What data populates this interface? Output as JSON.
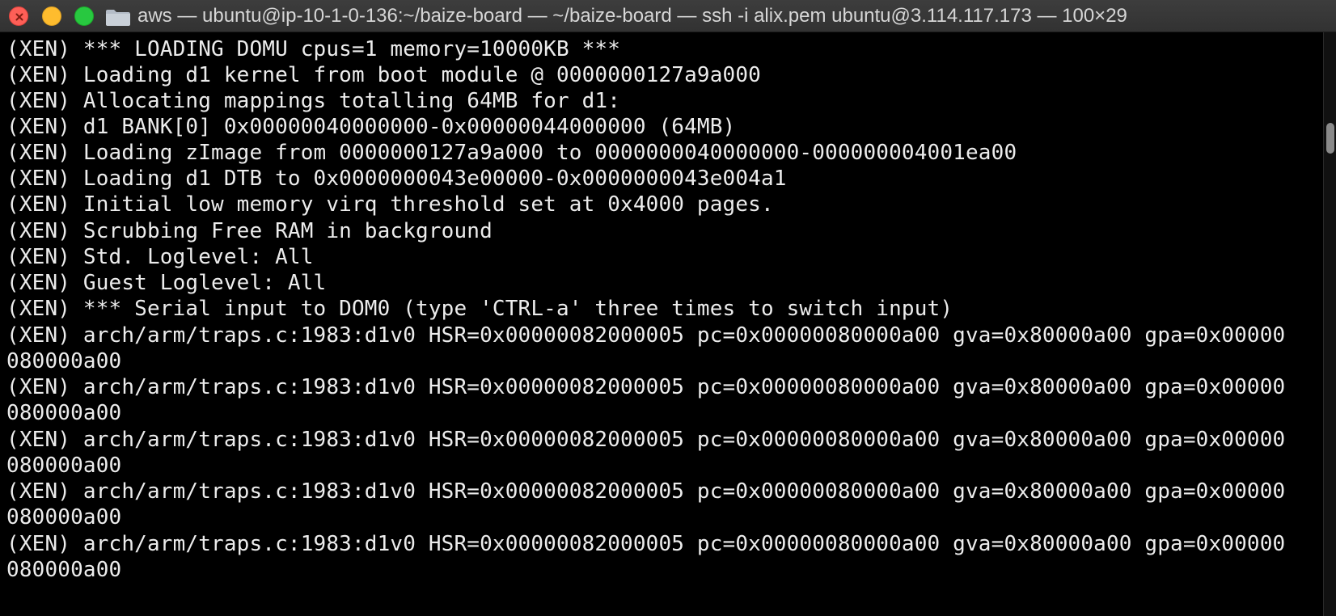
{
  "window": {
    "title": "aws — ubuntu@ip-10-1-0-136:~/baize-board — ~/baize-board — ssh -i alix.pem ubuntu@3.114.117.173 — 100×29"
  },
  "icons": {
    "folder": "folder-icon",
    "close": "close-icon",
    "minimize": "minimize-icon",
    "zoom": "zoom-icon"
  },
  "colors": {
    "terminal_background": "#000000",
    "terminal_text": "#ececec",
    "close": "#fe5f57",
    "minimize": "#febc2e",
    "zoom": "#28c840"
  },
  "terminal": {
    "lines": [
      "(XEN) *** LOADING DOMU cpus=1 memory=10000KB ***",
      "(XEN) Loading d1 kernel from boot module @ 0000000127a9a000",
      "(XEN) Allocating mappings totalling 64MB for d1:",
      "(XEN) d1 BANK[0] 0x00000040000000-0x00000044000000 (64MB)",
      "(XEN) Loading zImage from 0000000127a9a000 to 0000000040000000-000000004001ea00",
      "(XEN) Loading d1 DTB to 0x0000000043e00000-0x0000000043e004a1",
      "(XEN) Initial low memory virq threshold set at 0x4000 pages.",
      "(XEN) Scrubbing Free RAM in background",
      "(XEN) Std. Loglevel: All",
      "(XEN) Guest Loglevel: All",
      "(XEN) *** Serial input to DOM0 (type 'CTRL-a' three times to switch input)",
      "(XEN) arch/arm/traps.c:1983:d1v0 HSR=0x00000082000005 pc=0x00000080000a00 gva=0x80000a00 gpa=0x00000",
      "080000a00",
      "(XEN) arch/arm/traps.c:1983:d1v0 HSR=0x00000082000005 pc=0x00000080000a00 gva=0x80000a00 gpa=0x00000",
      "080000a00",
      "(XEN) arch/arm/traps.c:1983:d1v0 HSR=0x00000082000005 pc=0x00000080000a00 gva=0x80000a00 gpa=0x00000",
      "080000a00",
      "(XEN) arch/arm/traps.c:1983:d1v0 HSR=0x00000082000005 pc=0x00000080000a00 gva=0x80000a00 gpa=0x00000",
      "080000a00",
      "(XEN) arch/arm/traps.c:1983:d1v0 HSR=0x00000082000005 pc=0x00000080000a00 gva=0x80000a00 gpa=0x00000",
      "080000a00"
    ]
  }
}
